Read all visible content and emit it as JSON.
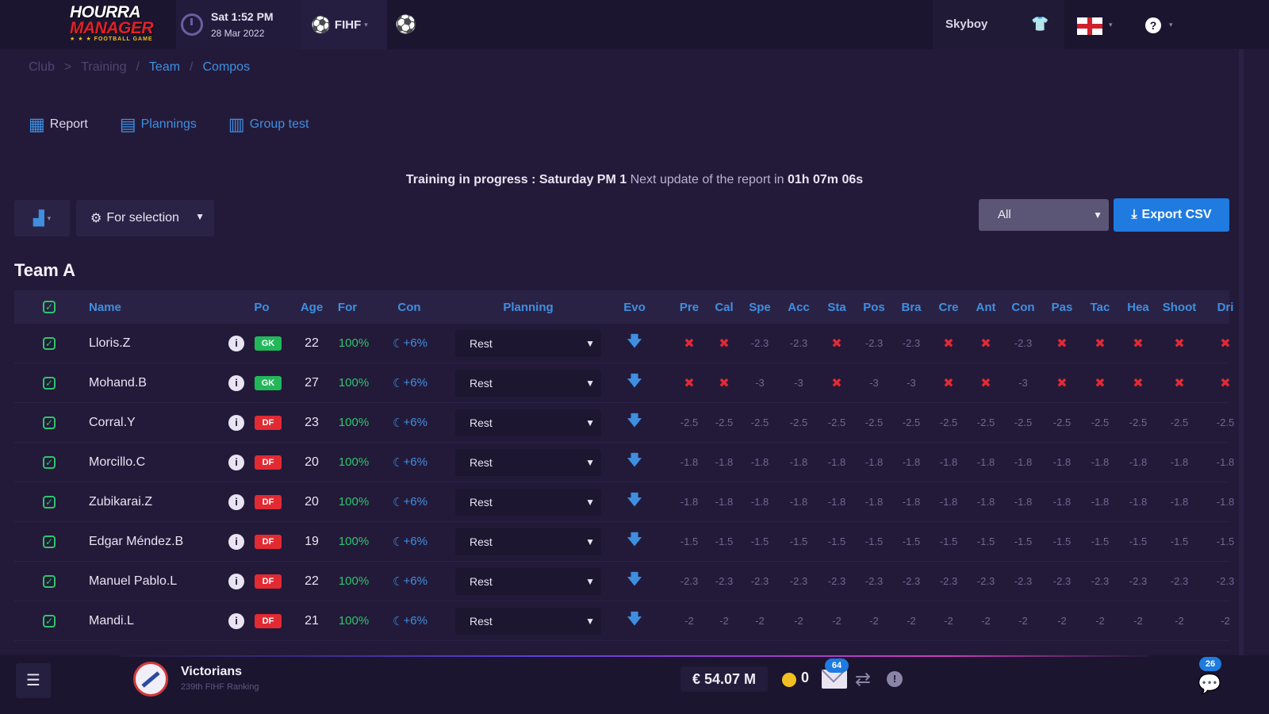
{
  "header": {
    "logo_line1": "HOURRA",
    "logo_line2": "MANAGER",
    "logo_line3": "★ ★ ★ FOOTBALL GAME",
    "time": "Sat 1:52 PM",
    "date": "28 Mar 2022",
    "federation": "FIHF",
    "username": "Skyboy"
  },
  "breadcrumb": [
    "Club",
    ">",
    "Training",
    "/",
    "Team",
    "/",
    "Compos"
  ],
  "subnav": [
    {
      "label": "Report",
      "icon": "report-icon"
    },
    {
      "label": "Plannings",
      "icon": "calendar-icon"
    },
    {
      "label": "Group test",
      "icon": "group-icon"
    }
  ],
  "progress": {
    "lead": "Training in progress : Saturday PM 1",
    "middle": "Next update of the report in",
    "remaining": "01h 07m 06s"
  },
  "filters": {
    "selection": "For selection",
    "scope": "All",
    "export_label": "Export CSV"
  },
  "team_title": "Team A",
  "columns": {
    "name": "Name",
    "po": "Po",
    "age": "Age",
    "for": "For",
    "con": "Con",
    "planning": "Planning",
    "evo": "Evo",
    "stats": [
      "Pre",
      "Cal",
      "Spe",
      "Acc",
      "Sta",
      "Pos",
      "Bra",
      "Cre",
      "Ant",
      "Con",
      "Pas",
      "Tac",
      "Hea",
      "Shoot",
      "Dri"
    ]
  },
  "players": [
    {
      "name": "Lloris.Z",
      "pos": "GK",
      "age": "22",
      "form": "100%",
      "con": "+6%",
      "planning": "Rest",
      "stats": [
        "x",
        "x",
        "-2.3",
        "-2.3",
        "x",
        "-2.3",
        "-2.3",
        "x",
        "x",
        "-2.3",
        "x",
        "x",
        "x",
        "x",
        "x"
      ]
    },
    {
      "name": "Mohand.B",
      "pos": "GK",
      "age": "27",
      "form": "100%",
      "con": "+6%",
      "planning": "Rest",
      "stats": [
        "x",
        "x",
        "-3",
        "-3",
        "x",
        "-3",
        "-3",
        "x",
        "x",
        "-3",
        "x",
        "x",
        "x",
        "x",
        "x"
      ]
    },
    {
      "name": "Corral.Y",
      "pos": "DF",
      "age": "23",
      "form": "100%",
      "con": "+6%",
      "planning": "Rest",
      "stats": [
        "-2.5",
        "-2.5",
        "-2.5",
        "-2.5",
        "-2.5",
        "-2.5",
        "-2.5",
        "-2.5",
        "-2.5",
        "-2.5",
        "-2.5",
        "-2.5",
        "-2.5",
        "-2.5",
        "-2.5"
      ]
    },
    {
      "name": "Morcillo.C",
      "pos": "DF",
      "age": "20",
      "form": "100%",
      "con": "+6%",
      "planning": "Rest",
      "stats": [
        "-1.8",
        "-1.8",
        "-1.8",
        "-1.8",
        "-1.8",
        "-1.8",
        "-1.8",
        "-1.8",
        "-1.8",
        "-1.8",
        "-1.8",
        "-1.8",
        "-1.8",
        "-1.8",
        "-1.8"
      ]
    },
    {
      "name": "Zubikarai.Z",
      "pos": "DF",
      "age": "20",
      "form": "100%",
      "con": "+6%",
      "planning": "Rest",
      "stats": [
        "-1.8",
        "-1.8",
        "-1.8",
        "-1.8",
        "-1.8",
        "-1.8",
        "-1.8",
        "-1.8",
        "-1.8",
        "-1.8",
        "-1.8",
        "-1.8",
        "-1.8",
        "-1.8",
        "-1.8"
      ]
    },
    {
      "name": "Edgar Méndez.B",
      "pos": "DF",
      "age": "19",
      "form": "100%",
      "con": "+6%",
      "planning": "Rest",
      "stats": [
        "-1.5",
        "-1.5",
        "-1.5",
        "-1.5",
        "-1.5",
        "-1.5",
        "-1.5",
        "-1.5",
        "-1.5",
        "-1.5",
        "-1.5",
        "-1.5",
        "-1.5",
        "-1.5",
        "-1.5"
      ]
    },
    {
      "name": "Manuel Pablo.L",
      "pos": "DF",
      "age": "22",
      "form": "100%",
      "con": "+6%",
      "planning": "Rest",
      "stats": [
        "-2.3",
        "-2.3",
        "-2.3",
        "-2.3",
        "-2.3",
        "-2.3",
        "-2.3",
        "-2.3",
        "-2.3",
        "-2.3",
        "-2.3",
        "-2.3",
        "-2.3",
        "-2.3",
        "-2.3"
      ]
    },
    {
      "name": "Mandi.L",
      "pos": "DF",
      "age": "21",
      "form": "100%",
      "con": "+6%",
      "planning": "Rest",
      "stats": [
        "-2",
        "-2",
        "-2",
        "-2",
        "-2",
        "-2",
        "-2",
        "-2",
        "-2",
        "-2",
        "-2",
        "-2",
        "-2",
        "-2",
        "-2"
      ]
    }
  ],
  "footer": {
    "club_name": "Victorians",
    "club_rank": "239th FIHF Ranking",
    "money": "€ 54.07 M",
    "coins": "0",
    "mail_count": "64",
    "chat_count": "26"
  },
  "colors": {
    "accent": "#1f7be0",
    "positive": "#2fc46a",
    "negative": "#e22a33",
    "background": "#231a3a"
  }
}
